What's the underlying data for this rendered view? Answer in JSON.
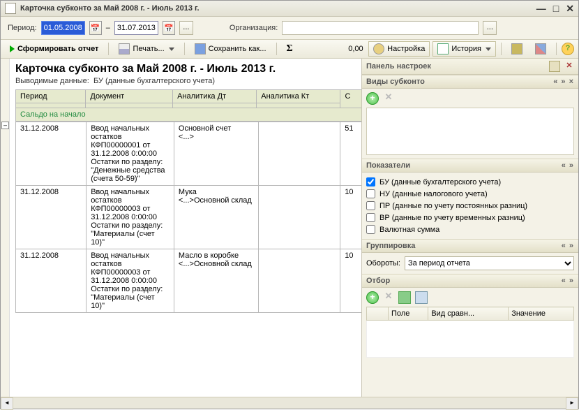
{
  "window": {
    "title": "Карточка субконто  за Май 2008 г. - Июль 2013 г."
  },
  "form": {
    "period_label": "Период:",
    "date_from": "01.05.2008",
    "date_to": "31.07.2013",
    "org_label": "Организация:",
    "org_value": "",
    "dots": "...",
    "dash": "–"
  },
  "toolbar": {
    "generate": "Сформировать отчет",
    "print": "Печать...",
    "save": "Сохранить как...",
    "sum_value": "0,00",
    "settings": "Настройка",
    "history": "История"
  },
  "report": {
    "title": "Карточка субконто  за Май 2008 г. - Июль 2013 г.",
    "sub_prefix": "Выводимые данные:",
    "sub_value": "БУ (данные бухгалтерского учета)",
    "cols": {
      "c0": "Период",
      "c1": "Документ",
      "c2": "Аналитика Дт",
      "c3": "Аналитика Кт",
      "c4": "С"
    },
    "group1": "Сальдо на начало",
    "rows": [
      {
        "c0": "31.12.2008",
        "c1": "Ввод начальных остатков КФП00000001 от 31.12.2008 0:00:00\nОстатки по разделу: \"Денежные средства (счета 50-59)\"",
        "c2": "Основной счет\n<...>",
        "c3": "",
        "c4": "51"
      },
      {
        "c0": "31.12.2008",
        "c1": "Ввод начальных остатков КФП00000003 от 31.12.2008 0:00:00\nОстатки по разделу: \"Материалы (счет 10)\"",
        "c2": "Мука\n<...>Основной склад",
        "c3": "",
        "c4": "10"
      },
      {
        "c0": "31.12.2008",
        "c1": "Ввод начальных остатков КФП00000003 от 31.12.2008 0:00:00\nОстатки по разделу: \"Материалы (счет 10)\"",
        "c2": "Масло в коробке\n<...>Основной склад",
        "c3": "",
        "c4": "10"
      }
    ]
  },
  "rp": {
    "panel_title": "Панель настроек",
    "s1": "Виды субконто",
    "s2": "Показатели",
    "s3": "Группировка",
    "s4": "Отбор",
    "indicators": [
      {
        "label": "БУ (данные бухгалтерского учета)",
        "checked": true
      },
      {
        "label": "НУ (данные налогового учета)",
        "checked": false
      },
      {
        "label": "ПР (данные по учету постоянных разниц)",
        "checked": false
      },
      {
        "label": "ВР (данные по учету временных разниц)",
        "checked": false
      },
      {
        "label": "Валютная сумма",
        "checked": false
      }
    ],
    "grp_label": "Обороты:",
    "grp_value": "За период отчета",
    "filter_cols": {
      "c0": "",
      "c1": "Поле",
      "c2": "Вид сравн...",
      "c3": "Значение"
    },
    "nav": "« »",
    "navx": "« » ×",
    "plus": "+",
    "cross": "✕",
    "minus": "–",
    "help": "?"
  }
}
